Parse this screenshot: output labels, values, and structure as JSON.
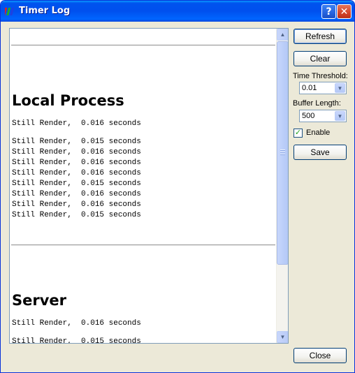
{
  "window": {
    "title": "Timer Log",
    "help_glyph": "?",
    "close_glyph": "✕"
  },
  "log": {
    "sections": [
      {
        "title": "Local Process",
        "first_line": "Still Render,  0.016 seconds",
        "lines": [
          "Still Render,  0.015 seconds",
          "Still Render,  0.016 seconds",
          "Still Render,  0.016 seconds",
          "Still Render,  0.016 seconds",
          "Still Render,  0.015 seconds",
          "Still Render,  0.016 seconds",
          "Still Render,  0.016 seconds",
          "Still Render,  0.015 seconds"
        ]
      },
      {
        "title": "Server",
        "first_line": "Still Render,  0.016 seconds",
        "lines": [
          "Still Render,  0.015 seconds"
        ]
      }
    ]
  },
  "controls": {
    "refresh_label": "Refresh",
    "clear_label": "Clear",
    "time_threshold_label": "Time Threshold:",
    "time_threshold_value": "0.01",
    "buffer_length_label": "Buffer Length:",
    "buffer_length_value": "500",
    "enable_label": "Enable",
    "enable_checked": true,
    "save_label": "Save",
    "close_label": "Close"
  },
  "icons": {
    "app_icon": "colored-bars-icon",
    "help_icon": "help-icon",
    "close_icon": "close-icon",
    "scroll_up": "arrow-up-icon",
    "scroll_down": "arrow-down-icon",
    "dropdown": "chevron-down-icon",
    "check": "checkmark-icon"
  },
  "colors": {
    "titlebar": "#0054e3",
    "window_bg": "#ece9d8",
    "close_button": "#d4452b"
  }
}
